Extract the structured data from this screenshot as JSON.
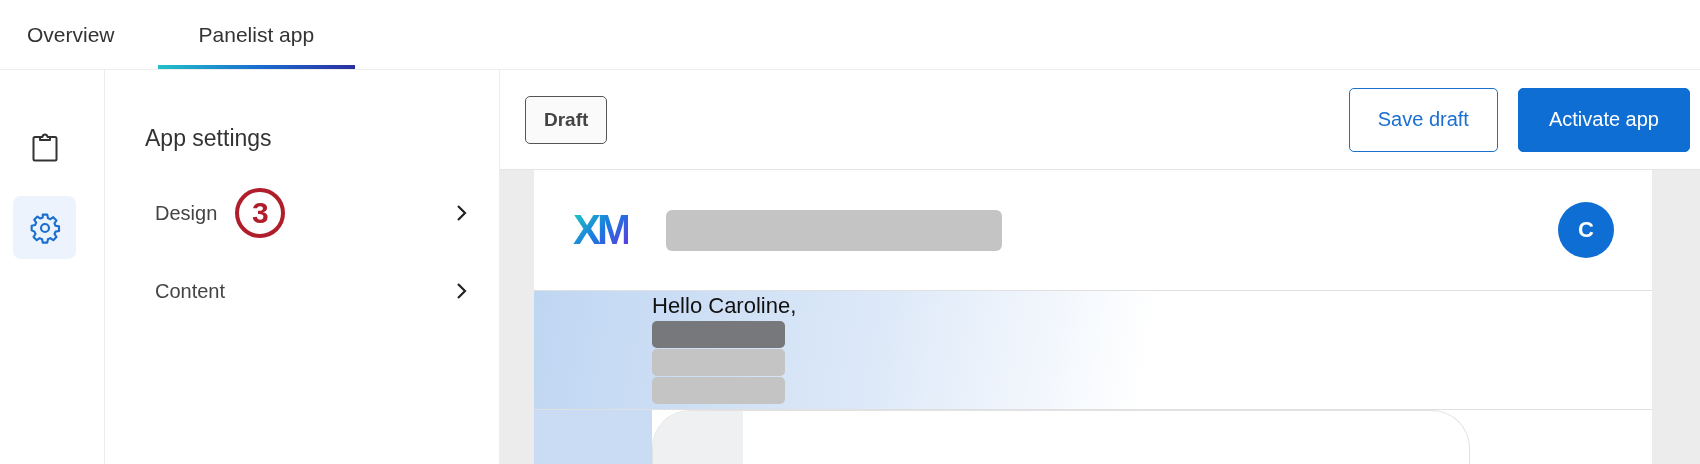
{
  "tabs": [
    {
      "label": "Overview",
      "selected": false
    },
    {
      "label": "Panelist app",
      "selected": true
    }
  ],
  "rail": [
    {
      "kind": "clipboard",
      "selected": false
    },
    {
      "kind": "settings",
      "selected": true
    }
  ],
  "settings_panel": {
    "title": "App settings",
    "items": [
      {
        "label": "Design",
        "callout": "3"
      },
      {
        "label": "Content"
      }
    ]
  },
  "toolbar": {
    "status": "Draft",
    "buttons": [
      {
        "label": "Save draft",
        "kind": "secondary"
      },
      {
        "label": "Activate app",
        "kind": "primary"
      }
    ]
  },
  "preview": {
    "logo": "XM",
    "avatar": "C",
    "greeting": "Hello Caroline,"
  }
}
